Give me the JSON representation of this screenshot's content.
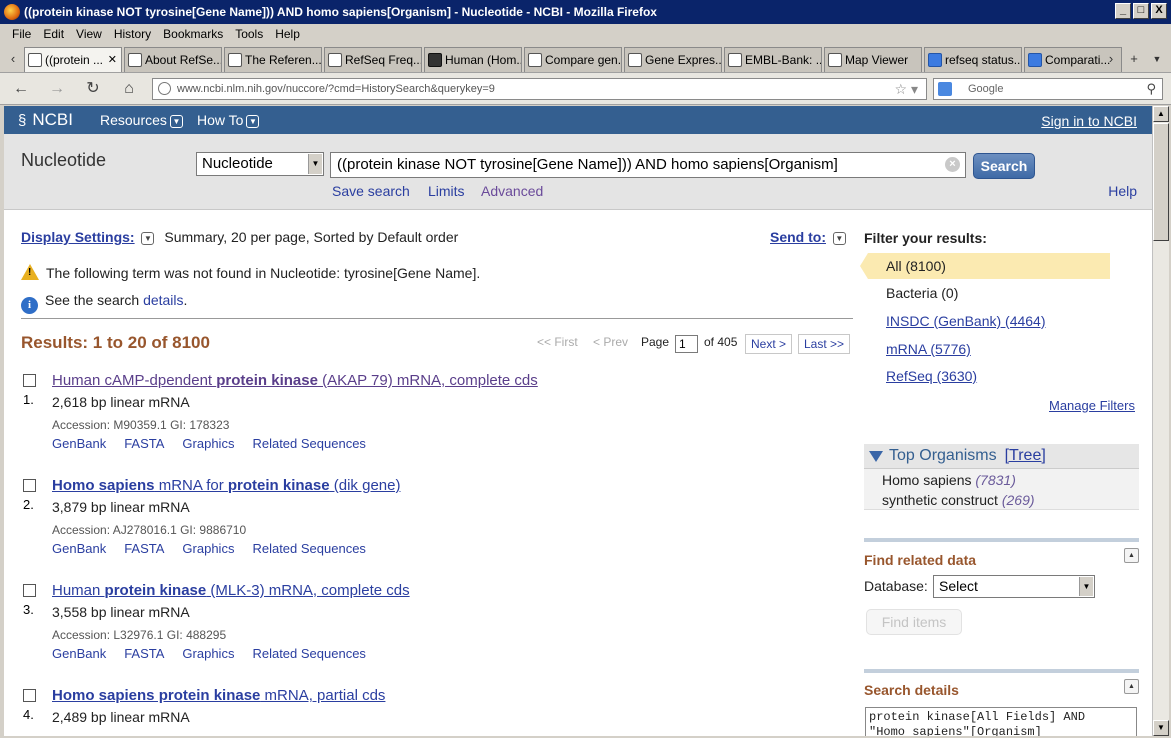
{
  "window": {
    "title": "((protein kinase NOT tyrosine[Gene Name])) AND homo sapiens[Organism] - Nucleotide - NCBI - Mozilla Firefox",
    "minimize": "_",
    "maximize": "□",
    "close": "X"
  },
  "menu": [
    "File",
    "Edit",
    "View",
    "History",
    "Bookmarks",
    "Tools",
    "Help"
  ],
  "tabs": [
    {
      "label": "((protein ...",
      "close": "✕"
    },
    {
      "label": "About RefSe..."
    },
    {
      "label": "The Referen..."
    },
    {
      "label": "RefSeq Freq..."
    },
    {
      "label": "Human (Hom..."
    },
    {
      "label": "Compare gen..."
    },
    {
      "label": "Gene Expres..."
    },
    {
      "label": "EMBL-Bank: ..."
    },
    {
      "label": "Map Viewer"
    },
    {
      "label": "refseq status..."
    },
    {
      "label": "Comparati..."
    }
  ],
  "nav": {
    "url": "www.ncbi.nlm.nih.gov/nuccore/?cmd=HistorySearch&querykey=9",
    "search_placeholder": "Google"
  },
  "ncbi": {
    "logo": "NCBI",
    "resources": "Resources",
    "howto": "How To",
    "signin": "Sign in to NCBI"
  },
  "search": {
    "db_title": "Nucleotide",
    "db_selected": "Nucleotide",
    "term": "((protein kinase NOT tyrosine[Gene Name])) AND homo sapiens[Organism]",
    "button": "Search",
    "save": "Save search",
    "limits": "Limits",
    "advanced": "Advanced",
    "help": "Help"
  },
  "display": {
    "label": "Display Settings:",
    "summary": "Summary, 20 per page, Sorted by Default order",
    "send_to": "Send to:"
  },
  "messages": {
    "warning": "The following term was not found in Nucleotide: tyrosine[Gene Name].",
    "info_prefix": "See the search",
    "info_link": "details",
    "info_suffix": "."
  },
  "results": {
    "count": "Results: 1 to 20 of 8100",
    "first": "<< First",
    "prev": "< Prev",
    "page_label": "Page",
    "page": "1",
    "of": "of 405",
    "next": "Next >",
    "last": "Last >>",
    "items": [
      {
        "num": "1.",
        "title_a": "Human cAMP-dpendent ",
        "title_b": "protein kinase",
        "title_c": " (AKAP 79) mRNA, complete cds",
        "desc": "2,618 bp linear mRNA",
        "acc": "Accession: M90359.1   GI: 178323"
      },
      {
        "num": "2.",
        "title_a": "Homo sapiens",
        "title_b": " mRNA for ",
        "title_c": "protein kinase",
        "title_d": " (dik gene)",
        "desc": "3,879 bp linear mRNA",
        "acc": "Accession: AJ278016.1   GI: 9886710"
      },
      {
        "num": "3.",
        "title_a": "Human ",
        "title_b": "protein kinase",
        "title_c": " (MLK-3) mRNA, complete cds",
        "desc": "3,558 bp linear mRNA",
        "acc": "Accession: L32976.1   GI: 488295"
      },
      {
        "num": "4.",
        "title_a": "Homo sapiens protein kinase",
        "title_b": " mRNA, partial cds",
        "desc": "2,489 bp linear mRNA"
      }
    ],
    "links": [
      "GenBank",
      "FASTA",
      "Graphics",
      "Related Sequences"
    ]
  },
  "filters": {
    "title": "Filter your results:",
    "items": [
      "All (8100)",
      "Bacteria (0)",
      "INSDC (GenBank) (4464)",
      "mRNA (5776)",
      "RefSeq (3630)"
    ],
    "manage": "Manage Filters"
  },
  "organisms": {
    "title": "Top Organisms",
    "tree": "[Tree]",
    "items": [
      {
        "name": "Homo sapiens",
        "count": "(7831)"
      },
      {
        "name": "synthetic construct",
        "count": "(269)"
      }
    ]
  },
  "related": {
    "title": "Find related data",
    "db_label": "Database:",
    "db_selected": "Select",
    "button": "Find items"
  },
  "details": {
    "title": "Search details",
    "query": "protein kinase[All Fields] AND\n\"Homo sapiens\"[Organism]"
  }
}
